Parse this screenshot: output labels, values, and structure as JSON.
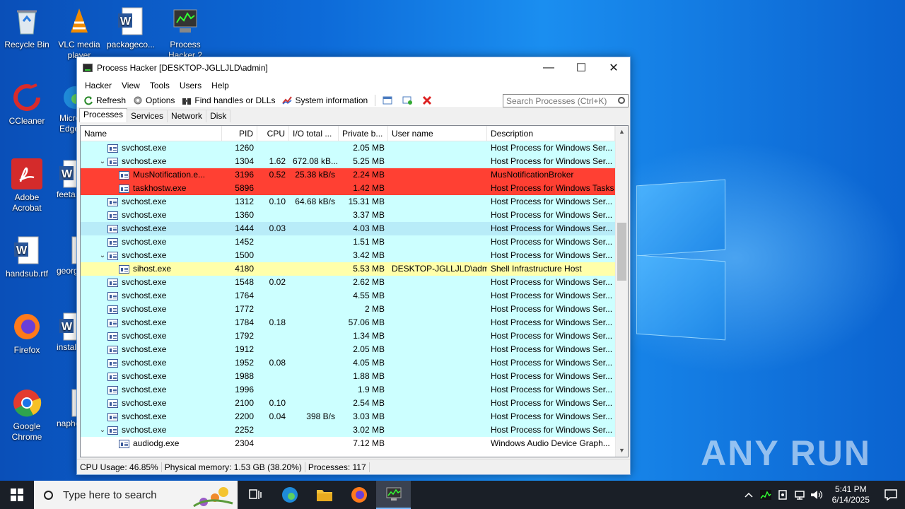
{
  "desktop": {
    "icons": [
      {
        "label": "Recycle Bin"
      },
      {
        "label": "VLC media player"
      },
      {
        "label": "packageco..."
      },
      {
        "label": "Process Hacker 2"
      },
      {
        "label": "CCleaner"
      },
      {
        "label": "Microsoft Edge"
      },
      {
        "label": "Adobe Acrobat"
      },
      {
        "label": "feeta..."
      },
      {
        "label": "handsub.rtf"
      },
      {
        "label": "georg..."
      },
      {
        "label": "Firefox"
      },
      {
        "label": "instal..."
      },
      {
        "label": "Google Chrome"
      },
      {
        "label": "napho..."
      }
    ],
    "watermark": "ANY RUN"
  },
  "window": {
    "title": "Process Hacker [DESKTOP-JGLLJLD\\admin]",
    "menu": [
      "Hacker",
      "View",
      "Tools",
      "Users",
      "Help"
    ],
    "toolbar": {
      "refresh": "Refresh",
      "options": "Options",
      "find_handles": "Find handles or DLLs",
      "sysinfo": "System information"
    },
    "search_placeholder": "Search Processes (Ctrl+K)",
    "tabs": [
      "Processes",
      "Services",
      "Network",
      "Disk"
    ],
    "columns": [
      "Name",
      "PID",
      "CPU",
      "I/O total ...",
      "Private b...",
      "User name",
      "Description"
    ],
    "rows": [
      {
        "name": "svchost.exe",
        "pid": "1260",
        "cpu": "",
        "io": "",
        "priv": "2.05 MB",
        "user": "",
        "desc": "Host Process for Windows Ser...",
        "level": 1,
        "expander": "",
        "bg": "#ccffff"
      },
      {
        "name": "svchost.exe",
        "pid": "1304",
        "cpu": "1.62",
        "io": "672.08 kB...",
        "priv": "5.25 MB",
        "user": "",
        "desc": "Host Process for Windows Ser...",
        "level": 1,
        "expander": "v",
        "bg": "#ccffff"
      },
      {
        "name": "MusNotification.e...",
        "pid": "3196",
        "cpu": "0.52",
        "io": "25.38 kB/s",
        "priv": "2.24 MB",
        "user": "",
        "desc": "MusNotificationBroker",
        "level": 2,
        "expander": "",
        "bg": "#ff4033"
      },
      {
        "name": "taskhostw.exe",
        "pid": "5896",
        "cpu": "",
        "io": "",
        "priv": "1.42 MB",
        "user": "",
        "desc": "Host Process for Windows Tasks",
        "level": 2,
        "expander": "",
        "bg": "#ff4033"
      },
      {
        "name": "svchost.exe",
        "pid": "1312",
        "cpu": "0.10",
        "io": "64.68 kB/s",
        "priv": "15.31 MB",
        "user": "",
        "desc": "Host Process for Windows Ser...",
        "level": 1,
        "expander": "",
        "bg": "#ccffff"
      },
      {
        "name": "svchost.exe",
        "pid": "1360",
        "cpu": "",
        "io": "",
        "priv": "3.37 MB",
        "user": "",
        "desc": "Host Process for Windows Ser...",
        "level": 1,
        "expander": "",
        "bg": "#ccffff"
      },
      {
        "name": "svchost.exe",
        "pid": "1444",
        "cpu": "0.03",
        "io": "",
        "priv": "4.03 MB",
        "user": "",
        "desc": "Host Process for Windows Ser...",
        "level": 1,
        "expander": "",
        "bg": "#b8ecf8"
      },
      {
        "name": "svchost.exe",
        "pid": "1452",
        "cpu": "",
        "io": "",
        "priv": "1.51 MB",
        "user": "",
        "desc": "Host Process for Windows Ser...",
        "level": 1,
        "expander": "",
        "bg": "#ccffff"
      },
      {
        "name": "svchost.exe",
        "pid": "1500",
        "cpu": "",
        "io": "",
        "priv": "3.42 MB",
        "user": "",
        "desc": "Host Process for Windows Ser...",
        "level": 1,
        "expander": "v",
        "bg": "#ccffff"
      },
      {
        "name": "sihost.exe",
        "pid": "4180",
        "cpu": "",
        "io": "",
        "priv": "5.53 MB",
        "user": "DESKTOP-JGLLJLD\\admi",
        "desc": "Shell Infrastructure Host",
        "level": 2,
        "expander": "",
        "bg": "#ffffaa"
      },
      {
        "name": "svchost.exe",
        "pid": "1548",
        "cpu": "0.02",
        "io": "",
        "priv": "2.62 MB",
        "user": "",
        "desc": "Host Process for Windows Ser...",
        "level": 1,
        "expander": "",
        "bg": "#ccffff"
      },
      {
        "name": "svchost.exe",
        "pid": "1764",
        "cpu": "",
        "io": "",
        "priv": "4.55 MB",
        "user": "",
        "desc": "Host Process for Windows Ser...",
        "level": 1,
        "expander": "",
        "bg": "#ccffff"
      },
      {
        "name": "svchost.exe",
        "pid": "1772",
        "cpu": "",
        "io": "",
        "priv": "2 MB",
        "user": "",
        "desc": "Host Process for Windows Ser...",
        "level": 1,
        "expander": "",
        "bg": "#ccffff"
      },
      {
        "name": "svchost.exe",
        "pid": "1784",
        "cpu": "0.18",
        "io": "",
        "priv": "57.06 MB",
        "user": "",
        "desc": "Host Process for Windows Ser...",
        "level": 1,
        "expander": "",
        "bg": "#ccffff"
      },
      {
        "name": "svchost.exe",
        "pid": "1792",
        "cpu": "",
        "io": "",
        "priv": "1.34 MB",
        "user": "",
        "desc": "Host Process for Windows Ser...",
        "level": 1,
        "expander": "",
        "bg": "#ccffff"
      },
      {
        "name": "svchost.exe",
        "pid": "1912",
        "cpu": "",
        "io": "",
        "priv": "2.05 MB",
        "user": "",
        "desc": "Host Process for Windows Ser...",
        "level": 1,
        "expander": "",
        "bg": "#ccffff"
      },
      {
        "name": "svchost.exe",
        "pid": "1952",
        "cpu": "0.08",
        "io": "",
        "priv": "4.05 MB",
        "user": "",
        "desc": "Host Process for Windows Ser...",
        "level": 1,
        "expander": "",
        "bg": "#ccffff"
      },
      {
        "name": "svchost.exe",
        "pid": "1988",
        "cpu": "",
        "io": "",
        "priv": "1.88 MB",
        "user": "",
        "desc": "Host Process for Windows Ser...",
        "level": 1,
        "expander": "",
        "bg": "#ccffff"
      },
      {
        "name": "svchost.exe",
        "pid": "1996",
        "cpu": "",
        "io": "",
        "priv": "1.9 MB",
        "user": "",
        "desc": "Host Process for Windows Ser...",
        "level": 1,
        "expander": "",
        "bg": "#ccffff"
      },
      {
        "name": "svchost.exe",
        "pid": "2100",
        "cpu": "0.10",
        "io": "",
        "priv": "2.54 MB",
        "user": "",
        "desc": "Host Process for Windows Ser...",
        "level": 1,
        "expander": "",
        "bg": "#ccffff"
      },
      {
        "name": "svchost.exe",
        "pid": "2200",
        "cpu": "0.04",
        "io": "398 B/s",
        "priv": "3.03 MB",
        "user": "",
        "desc": "Host Process for Windows Ser...",
        "level": 1,
        "expander": "",
        "bg": "#ccffff"
      },
      {
        "name": "svchost.exe",
        "pid": "2252",
        "cpu": "",
        "io": "",
        "priv": "3.02 MB",
        "user": "",
        "desc": "Host Process for Windows Ser...",
        "level": 1,
        "expander": "v",
        "bg": "#ccffff"
      },
      {
        "name": "audiodg.exe",
        "pid": "2304",
        "cpu": "",
        "io": "",
        "priv": "7.12 MB",
        "user": "",
        "desc": "Windows Audio Device Graph...",
        "level": 2,
        "expander": "",
        "bg": "#ffffff"
      }
    ],
    "status": {
      "cpu": "CPU Usage: 46.85%",
      "memory": "Physical memory: 1.53 GB (38.20%)",
      "processes": "Processes: 117"
    }
  },
  "taskbar": {
    "search_placeholder": "Type here to search",
    "time": "5:41 PM",
    "date": "6/14/2025"
  }
}
